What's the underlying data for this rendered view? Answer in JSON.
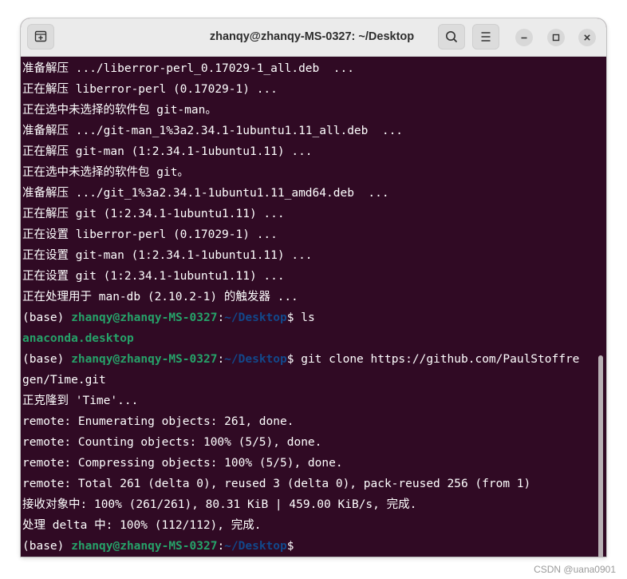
{
  "window": {
    "title": "zhanqy@zhanqy-MS-0327: ~/Desktop"
  },
  "titlebar": {
    "new_tab_icon": "new-tab-icon",
    "search_icon": "search-icon",
    "menu_icon": "hamburger-menu-icon",
    "minimize_icon": "minimize-icon",
    "maximize_icon": "maximize-icon",
    "close_icon": "close-icon"
  },
  "terminal": {
    "lines": [
      "准备解压 .../liberror-perl_0.17029-1_all.deb  ...",
      "正在解压 liberror-perl (0.17029-1) ...",
      "正在选中未选择的软件包 git-man。",
      "准备解压 .../git-man_1%3a2.34.1-1ubuntu1.11_all.deb  ...",
      "正在解压 git-man (1:2.34.1-1ubuntu1.11) ...",
      "正在选中未选择的软件包 git。",
      "准备解压 .../git_1%3a2.34.1-1ubuntu1.11_amd64.deb  ...",
      "正在解压 git (1:2.34.1-1ubuntu1.11) ...",
      "正在设置 liberror-perl (0.17029-1) ...",
      "正在设置 git-man (1:2.34.1-1ubuntu1.11) ...",
      "正在设置 git (1:2.34.1-1ubuntu1.11) ...",
      "正在处理用于 man-db (2.10.2-1) 的触发器 ..."
    ],
    "prompt1": {
      "env": "(base) ",
      "user": "zhanqy@zhanqy-MS-0327",
      "colon": ":",
      "path": "~/Desktop",
      "dollar": "$ ",
      "command": "ls"
    },
    "ls_output": "anaconda.desktop",
    "prompt2": {
      "env": "(base) ",
      "user": "zhanqy@zhanqy-MS-0327",
      "colon": ":",
      "path": "~/Desktop",
      "dollar": "$ ",
      "command": "git clone https://github.com/PaulStoffre"
    },
    "command_wrap": "gen/Time.git",
    "clone_output": [
      "正克隆到 'Time'...",
      "remote: Enumerating objects: 261, done.",
      "remote: Counting objects: 100% (5/5), done.",
      "remote: Compressing objects: 100% (5/5), done.",
      "remote: Total 261 (delta 0), reused 3 (delta 0), pack-reused 256 (from 1)",
      "接收对象中: 100% (261/261), 80.31 KiB | 459.00 KiB/s, 完成.",
      "处理 delta 中: 100% (112/112), 完成."
    ],
    "prompt3": {
      "env": "(base) ",
      "user": "zhanqy@zhanqy-MS-0327",
      "colon": ":",
      "path": "~/Desktop",
      "dollar": "$"
    }
  },
  "watermark": "CSDN @uana0901",
  "colors": {
    "terminal_bg": "#300a24",
    "prompt_user": "#26a269",
    "prompt_path": "#12488b",
    "text": "#ffffff"
  }
}
